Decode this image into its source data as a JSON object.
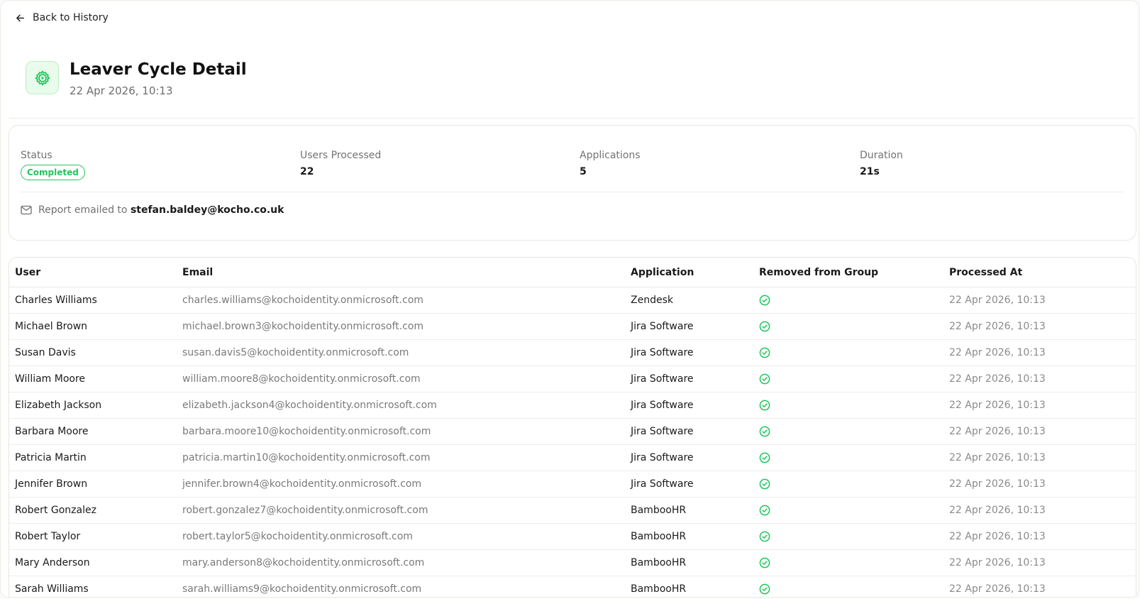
{
  "nav": {
    "back_label": "Back to History"
  },
  "header": {
    "title": "Leaver Cycle Detail",
    "timestamp": "22 Apr 2026, 10:13",
    "icon": "gear-play-icon"
  },
  "summary": {
    "status_label": "Status",
    "status_value": "Completed",
    "users_label": "Users Processed",
    "users_value": "22",
    "apps_label": "Applications",
    "apps_value": "5",
    "duration_label": "Duration",
    "duration_value": "21s",
    "report_prefix": "Report emailed to",
    "report_email": "stefan.baldey@kocho.co.uk"
  },
  "table": {
    "columns": [
      "User",
      "Email",
      "Application",
      "Removed from Group",
      "Processed At"
    ],
    "rows": [
      {
        "user": "Charles Williams",
        "email": "charles.williams@kochoidentity.onmicrosoft.com",
        "app": "Zendesk",
        "removed": true,
        "time": "22 Apr 2026, 10:13"
      },
      {
        "user": "Michael Brown",
        "email": "michael.brown3@kochoidentity.onmicrosoft.com",
        "app": "Jira Software",
        "removed": true,
        "time": "22 Apr 2026, 10:13"
      },
      {
        "user": "Susan Davis",
        "email": "susan.davis5@kochoidentity.onmicrosoft.com",
        "app": "Jira Software",
        "removed": true,
        "time": "22 Apr 2026, 10:13"
      },
      {
        "user": "William Moore",
        "email": "william.moore8@kochoidentity.onmicrosoft.com",
        "app": "Jira Software",
        "removed": true,
        "time": "22 Apr 2026, 10:13"
      },
      {
        "user": "Elizabeth Jackson",
        "email": "elizabeth.jackson4@kochoidentity.onmicrosoft.com",
        "app": "Jira Software",
        "removed": true,
        "time": "22 Apr 2026, 10:13"
      },
      {
        "user": "Barbara Moore",
        "email": "barbara.moore10@kochoidentity.onmicrosoft.com",
        "app": "Jira Software",
        "removed": true,
        "time": "22 Apr 2026, 10:13"
      },
      {
        "user": "Patricia Martin",
        "email": "patricia.martin10@kochoidentity.onmicrosoft.com",
        "app": "Jira Software",
        "removed": true,
        "time": "22 Apr 2026, 10:13"
      },
      {
        "user": "Jennifer Brown",
        "email": "jennifer.brown4@kochoidentity.onmicrosoft.com",
        "app": "Jira Software",
        "removed": true,
        "time": "22 Apr 2026, 10:13"
      },
      {
        "user": "Robert Gonzalez",
        "email": "robert.gonzalez7@kochoidentity.onmicrosoft.com",
        "app": "BambooHR",
        "removed": true,
        "time": "22 Apr 2026, 10:13"
      },
      {
        "user": "Robert Taylor",
        "email": "robert.taylor5@kochoidentity.onmicrosoft.com",
        "app": "BambooHR",
        "removed": true,
        "time": "22 Apr 2026, 10:13"
      },
      {
        "user": "Mary Anderson",
        "email": "mary.anderson8@kochoidentity.onmicrosoft.com",
        "app": "BambooHR",
        "removed": true,
        "time": "22 Apr 2026, 10:13"
      },
      {
        "user": "Sarah Williams",
        "email": "sarah.williams9@kochoidentity.onmicrosoft.com",
        "app": "BambooHR",
        "removed": true,
        "time": "22 Apr 2026, 10:13"
      }
    ]
  },
  "colors": {
    "accent_green": "#22c55e",
    "icon_bg": "#e9fbeb"
  }
}
